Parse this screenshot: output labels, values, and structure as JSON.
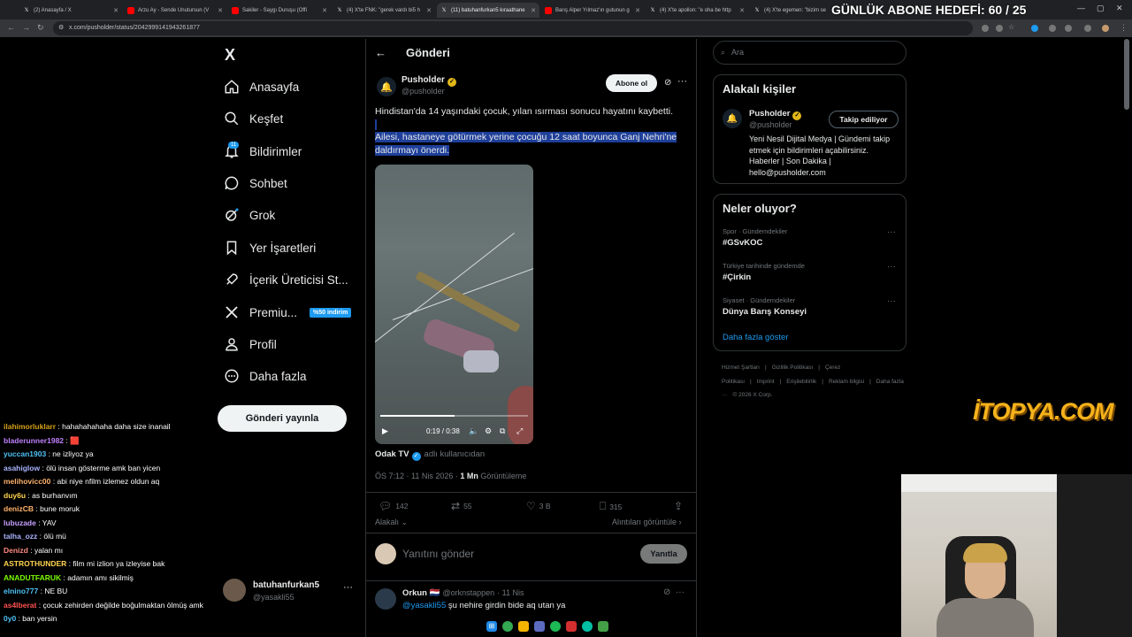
{
  "browser": {
    "tabs": [
      {
        "label": "(2) Anasayfa / X",
        "favicon": "x-icon",
        "active": false
      },
      {
        "label": "Arzu Ay - Sende Unutursun (V",
        "favicon": "youtube-icon",
        "active": false
      },
      {
        "label": "Sakiler - Saygı Duruşu (Offi",
        "favicon": "youtube-icon",
        "active": false
      },
      {
        "label": "(4) X'te FNK: \"gerek vardı bi5 h",
        "favicon": "x-icon",
        "active": false
      },
      {
        "label": "(11) batuhanfurkan5 kıraathane",
        "favicon": "x-icon",
        "active": true
      },
      {
        "label": "Barış Alper Yılmaz'ın gutunun g",
        "favicon": "youtube-icon",
        "active": false
      },
      {
        "label": "(4) X'te apollon: \"e oha be http",
        "favicon": "x-icon",
        "active": false
      },
      {
        "label": "(4) X'te egemen: \"bizim se",
        "favicon": "x-icon",
        "active": false
      }
    ],
    "url": "x.com/pusholder/status/2042999141943261877",
    "goal_overlay": "GÜNLÜK ABONE HEDEFİ: 60 / 25"
  },
  "sidebar": {
    "logo": "X",
    "items": [
      {
        "label": "Anasayfa",
        "icon": "home-icon"
      },
      {
        "label": "Keşfet",
        "icon": "search-icon"
      },
      {
        "label": "Bildirimler",
        "icon": "bell-icon",
        "badge": "11"
      },
      {
        "label": "Sohbet",
        "icon": "chat-icon"
      },
      {
        "label": "Grok",
        "icon": "grok-icon"
      },
      {
        "label": "Yer İşaretleri",
        "icon": "bookmark-icon"
      },
      {
        "label": "İçerik Üreticisi St...",
        "icon": "rocket-icon"
      },
      {
        "label": "Premiu...",
        "icon": "x-premium-icon",
        "tag": "%50 indirim"
      },
      {
        "label": "Profil",
        "icon": "person-icon"
      },
      {
        "label": "Daha fazla",
        "icon": "more-circle-icon"
      }
    ],
    "post_button": "Gönderi yayınla",
    "account": {
      "name": "batuhanfurkan5",
      "handle": "@yasakli55"
    }
  },
  "chat": [
    {
      "user": "ilahimorluklarr",
      "text": "hahahahahaha daha size inanail",
      "color": "#d4a017"
    },
    {
      "user": "bladerunner1982",
      "text": "🟥",
      "color": "#c080ff"
    },
    {
      "user": "yuccan1903",
      "text": "ne izliyoz ya",
      "color": "#4fc3f7"
    },
    {
      "user": "asahiglow",
      "text": "ölü insan gösterme amk ban yicen",
      "color": "#aab4ff"
    },
    {
      "user": "melihovicc00",
      "text": "abi niye nfilm izlemez oldun aq",
      "color": "#ffb36b"
    },
    {
      "user": "duy6u",
      "text": "as burhanvım",
      "color": "#ffd54f"
    },
    {
      "user": "denizCB",
      "text": "bune moruk",
      "color": "#ffb36b"
    },
    {
      "user": "lubuzade",
      "text": "YAV",
      "color": "#c9a0ff"
    },
    {
      "user": "talha_ozz",
      "text": "ölü mü",
      "color": "#aab4ff"
    },
    {
      "user": "Denizd",
      "text": "yalan mı",
      "color": "#ff8a80"
    },
    {
      "user": "ASTROTHUNDER",
      "text": "film mi izlion ya izleyise bak",
      "color": "#ffd54f"
    },
    {
      "user": "ANADUTFARUK",
      "text": "adamın amı sikilmiş",
      "color": "#7cfc00"
    },
    {
      "user": "elnino777",
      "text": "NE BU",
      "color": "#4fc3f7"
    },
    {
      "user": "as4lberat",
      "text": "çocuk zehirden değilde boğulmaktan ölmüş amk",
      "color": "#ff5252"
    },
    {
      "user": "0y0",
      "text": "ban yersin",
      "color": "#4fc3f7"
    }
  ],
  "main": {
    "title": "Gönderi",
    "author": {
      "name": "Pusholder",
      "handle": "@pusholder"
    },
    "subscribe": "Abone ol",
    "text_line1": "Hindistan'da 14 yaşındaki çocuk, yılan ısırması sonucu hayatını kaybetti.",
    "text_line2": "Ailesi, hastaneye götürmek yerine çocuğu 12 saat boyunca Ganj Nehri'ne daldırmayı önerdi.",
    "video": {
      "time": "0:19 / 0:38",
      "progress": 0.5
    },
    "source": {
      "name": "Odak TV",
      "suffix": "adlı kullanıcıdan"
    },
    "meta": {
      "timestamp": "ÖS 7:12 · 11 Nis 2026 · ",
      "views": "1 Mn",
      "views_label": " Görüntüleme"
    },
    "stats": {
      "replies": "142",
      "reposts": "55",
      "likes": "3 B",
      "bookmarks": "315"
    },
    "related_label": "Alakalı",
    "quotes_label": "Alıntıları görüntüle",
    "reply_placeholder": "Yanıtını gönder",
    "reply_button": "Yanıtla",
    "reply": {
      "name": "Orkun",
      "handle": "@orknstappen",
      "date": "· 11 Nis",
      "mention": "@yasakli55",
      "text": " şu nehire girdin bide aq utan ya"
    }
  },
  "right": {
    "search_placeholder": "Ara",
    "related_title": "Alakalı kişiler",
    "related_person": {
      "name": "Pusholder",
      "handle": "@pusholder",
      "button": "Takip ediliyor",
      "bio": "Yeni Nesil Dijital Medya | Gündemi takip etmek için bildirimleri açabilirsiniz. Haberler | Son Dakika | hello@pusholder.com"
    },
    "trends_title": "Neler oluyor?",
    "trends": [
      {
        "category": "Spor · Gündemdekiler",
        "name": "#GSvKOC"
      },
      {
        "category": "Türkiye tarihinde gündemde",
        "name": "#Çirkin"
      },
      {
        "category": "Siyaset · Gündemdekiler",
        "name": "Dünya Barış Konseyi"
      }
    ],
    "show_more": "Daha fazla göster",
    "footer": [
      "Hizmet Şartları",
      "|",
      "Gizlilik Politikası",
      "|",
      "Çerez Politikası",
      "|",
      "Imprint",
      "|",
      "Erişilebilirlik",
      "|",
      "Reklam bilgisi",
      "|",
      "Daha fazla ···",
      "© 2026 X Corp."
    ]
  },
  "overlays": {
    "logo_text": "İTOPYA.COM"
  }
}
